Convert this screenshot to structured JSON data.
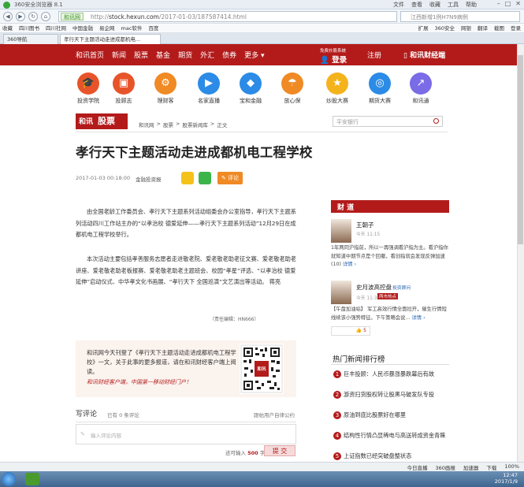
{
  "browser": {
    "title": "360安全浏览器 8.1",
    "menu": [
      "文件",
      "查看",
      "收藏",
      "工具",
      "帮助"
    ],
    "url_badge": "和讯网",
    "url_host": "stock.hexun.com",
    "url_path": "/2017-01-03/187587414.html",
    "search_text": "江西新增1例H7N9病例",
    "bookmarks": [
      "收藏",
      "四川图书",
      "四川社网",
      "中国金融",
      "易企网",
      "mac软件",
      "百度"
    ],
    "bookmarks_right": [
      "扩展",
      "360安全",
      "网银",
      "翻译",
      "截图",
      "登录"
    ],
    "tabs": [
      "360导航",
      "孝行天下主题活动走进成都机电..."
    ]
  },
  "site_nav": {
    "links": [
      "和讯首页",
      "新闻",
      "股票",
      "基金",
      "期货",
      "外汇",
      "债券",
      "更多"
    ],
    "login_sub": "免费炒股系统",
    "login": "登录",
    "register": "注册",
    "app": "和讯财经端"
  },
  "icons": [
    {
      "label": "投资学院",
      "icon": "mortarboard-icon",
      "color": "#e8542a",
      "glyph": "🎓"
    },
    {
      "label": "投顾志",
      "icon": "briefcase-icon",
      "color": "#e8542a",
      "glyph": "▣"
    },
    {
      "label": "理财客",
      "icon": "gear-icon",
      "color": "#f08a24",
      "glyph": "⚙"
    },
    {
      "label": "名家直播",
      "icon": "play-icon",
      "color": "#2b8be6",
      "glyph": "▶"
    },
    {
      "label": "宝和金融",
      "icon": "shield-icon",
      "color": "#2b8be6",
      "glyph": "◆"
    },
    {
      "label": "放心保",
      "icon": "umbrella-icon",
      "color": "#f08a24",
      "glyph": "☂"
    },
    {
      "label": "炒股大赛",
      "icon": "star-icon",
      "color": "#f5b31b",
      "glyph": "★"
    },
    {
      "label": "期货大赛",
      "icon": "chart-ring-icon",
      "color": "#2b8be6",
      "glyph": "◎"
    },
    {
      "label": "和讯通",
      "icon": "trend-icon",
      "color": "#7a6be6",
      "glyph": "↗"
    }
  ],
  "section": {
    "logo_left": "和讯",
    "logo_right": "股票",
    "breadcrumb": [
      "和讯网",
      ">",
      "股票",
      ">",
      "股票新闻库",
      ">",
      "正文"
    ],
    "search_placeholder": "平安银行"
  },
  "article": {
    "title": "孝行天下主题活动走进成都机电工程学校",
    "date": "2017-01-03 00:18:00",
    "source": "金融投资报",
    "comment_btn": "评论",
    "para1": "由全国老龄工作委员会、孝行天下主题系列活动组委会办公室指导，孝行天下主题系列活动四川工作站主办的“以孝治校 德爱延伸——孝行天下主题系列活动”12月29日在成都机电工程学校举行。",
    "para2": "本次活动主要包括孝善服务志愿者走进敬老院、爱老敬老助老征文赛、爱老敬老助老讲座、爱老敬老助老板报赛、爱老敬老助老主题班会、校园“孝星”评选、“以孝治校 德爱延伸”启动仪式、中华孝文化书画展、“孝行天下 全国巡演”文艺演出等活动。 蒋亮",
    "editor": "（责任编辑：HN666）"
  },
  "promo": {
    "text": "和讯网今天刊登了《孝行天下主题活动走进成都机电工程学校》一文，关于此事的更多报道，请在和讯财经客户端上阅读。",
    "slogan": "和讯财经客户端，中国第一移动财经门户！",
    "qr_badge": "和讯"
  },
  "comments": {
    "heading": "写评论",
    "count_text": "已有 0 条评论",
    "rules": "跟帖用户自律公约",
    "placeholder": "输入评论内容",
    "limit_prefix": "还可输入",
    "limit_num": "500",
    "limit_suffix": "字",
    "submit": "提 交"
  },
  "caijing": {
    "heading": "财 道",
    "item1_name": "王朝子",
    "item1_time": "今天 11:15",
    "item1_text": "1年两同沪指前，所以一再强调看沪指为主。看沪指你就知道中期节点是个回撤，看创指就会发现反弹加速(10)",
    "item1_link": "详情 ›",
    "item2_name": "史月波高控盘",
    "item2_tag": "投资顾问",
    "item2_time": "今天 11:34",
    "item2_badge": "两市热点",
    "item2_text": "【午盘加油站】 军工高效行情全面拉开，催生行情短线续该小强势特征。下午策略会说...",
    "item2_link": "详情 ›",
    "item2_count": "5"
  },
  "hotnews": {
    "heading": "热门新闻排行榜",
    "items": [
      {
        "n": "1",
        "t": "巨丰投顾：人民币暴涨暴跌幕后有故"
      },
      {
        "n": "2",
        "t": "游资扫货股权转让股黑马破发队专投"
      },
      {
        "n": "3",
        "t": "原油到底比股票好在哪里"
      },
      {
        "n": "4",
        "t": "结构性行情凸显稀电与高送转成资金青睐"
      },
      {
        "n": "5",
        "t": "上证指数已经突破盘整状态"
      }
    ]
  },
  "status": {
    "items": [
      "今日直播",
      "360画报",
      "加速器",
      "下载",
      "100%"
    ]
  },
  "taskbar": {
    "time": "12:47",
    "date": "2017/1/9"
  }
}
